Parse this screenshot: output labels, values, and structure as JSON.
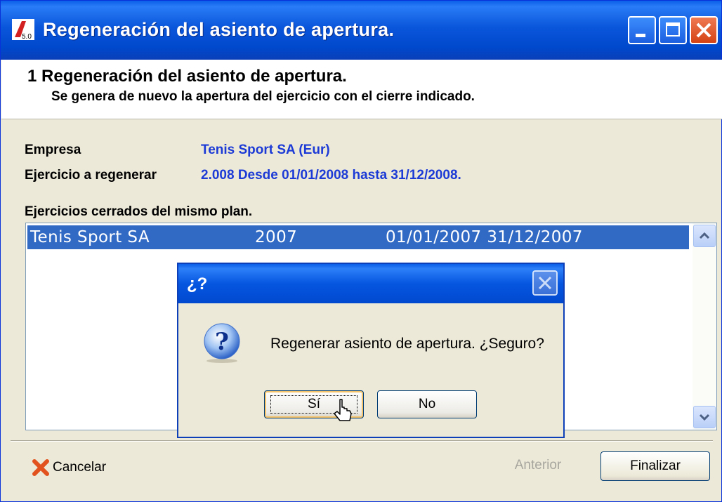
{
  "window": {
    "title": "Regeneración del asiento de apertura.",
    "icon": "app-logo-icon",
    "controls": [
      "minimize-icon",
      "maximize-icon",
      "close-icon"
    ]
  },
  "header": {
    "title": "1 Regeneración del asiento de apertura.",
    "subtitle": "Se genera de nuevo la apertura del ejercicio con el cierre indicado."
  },
  "form": {
    "empresa_label": "Empresa",
    "empresa_value": "Tenis Sport SA (Eur)",
    "ejercicio_label": "Ejercicio a regenerar",
    "ejercicio_value": "2.008 Desde 01/01/2008 hasta 31/12/2008.",
    "list_label": "Ejercicios cerrados del mismo plan."
  },
  "list": {
    "rows": [
      {
        "company": "Tenis Sport SA",
        "year": "2007",
        "period": "01/01/2007 31/12/2007"
      }
    ]
  },
  "dialog": {
    "title": "¿?",
    "message": "Regenerar asiento de apertura. ¿Seguro?",
    "yes_label": "Sí",
    "no_label": "No"
  },
  "footer": {
    "cancel_label": "Cancelar",
    "previous_label": "Anterior",
    "finish_label": "Finalizar"
  },
  "colors": {
    "titlebar": "#0054e3",
    "value_text": "#1b3ad6",
    "selection": "#316ac5"
  }
}
